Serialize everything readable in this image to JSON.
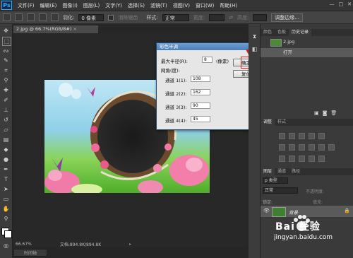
{
  "app": {
    "logo": "Ps",
    "menu": [
      "文件(F)",
      "编辑(E)",
      "图像(I)",
      "图层(L)",
      "文字(Y)",
      "选择(S)",
      "滤镜(T)",
      "视图(V)",
      "窗口(W)",
      "帮助(H)"
    ]
  },
  "options_bar": {
    "feather_label": "羽化:",
    "feather_value": "0 像素",
    "antialias_label": "消除锯齿",
    "style_label": "样式:",
    "style_value": "正常",
    "width_label": "宽度:",
    "height_label": "高度:",
    "refine_edge": "调整边缘..."
  },
  "document": {
    "tab_title": "2.jpg @ 66.7%(RGB/8#)",
    "zoom": "66.67%",
    "doc_size": "文档:894.8K/894.8K",
    "bottom_tab": "时间轴"
  },
  "dialog": {
    "title": "彩色半调",
    "max_radius_label": "最大半径(R):",
    "max_radius_value": "8",
    "unit": "(像素)",
    "screen_angle_label": "网角(度):",
    "channels": [
      {
        "label": "通道 1(1):",
        "value": "108"
      },
      {
        "label": "通道 2(2):",
        "value": "162"
      },
      {
        "label": "通道 3(3):",
        "value": "90"
      },
      {
        "label": "通道 4(4):",
        "value": "45"
      }
    ],
    "ok": "确定",
    "reset": "复位"
  },
  "panels": {
    "top_tabs": [
      "颜色",
      "色板",
      "历史记录"
    ],
    "history_snapshot": "2.jpg",
    "history_open": "打开",
    "adjust_tabs": [
      "调整",
      "样式"
    ],
    "layer_tabs": [
      "图层",
      "通道",
      "路径"
    ],
    "kind_value": "p 类型",
    "blend_value": "正常",
    "opacity_label": "不透明度:",
    "lock_label": "锁定:",
    "fill_label": "填充:",
    "layer_name": "背景"
  },
  "watermark": {
    "brand": "Bai 经验",
    "url": "jingyan.baidu.com"
  },
  "colors": {
    "accent": "#31a8ff",
    "highlight_box": "#e02020",
    "dialog_title": "#4a7fb8"
  }
}
